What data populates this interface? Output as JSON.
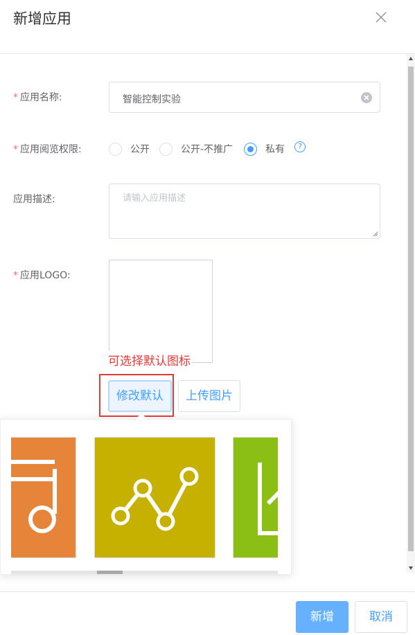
{
  "dialog": {
    "title": "新增应用",
    "close_icon": "close-icon"
  },
  "form": {
    "name": {
      "label": "应用名称:",
      "required_mark": "*",
      "value": "智能控制实验",
      "clear_icon": "clear-icon"
    },
    "permission": {
      "label": "应用阅览权限:",
      "required_mark": "*",
      "options": [
        {
          "label": "公开",
          "checked": false
        },
        {
          "label": "公开-不推广",
          "checked": false
        },
        {
          "label": "私有",
          "checked": true
        }
      ],
      "help_icon_text": "?"
    },
    "description": {
      "label": "应用描述:",
      "placeholder": "请输入应用描述",
      "value": ""
    },
    "logo": {
      "label": "应用LOGO:",
      "required_mark": "*",
      "annotation": "可选择默认图标",
      "modify_button": "修改默认",
      "upload_button": "上传图片"
    }
  },
  "icon_picker": {
    "icons": [
      {
        "name": "music-note-icon",
        "color": "#e6843a"
      },
      {
        "name": "line-chart-icon",
        "color": "#c6b000"
      },
      {
        "name": "area-chart-icon",
        "color": "#8cbf14"
      }
    ]
  },
  "footer": {
    "confirm_button": "新增",
    "cancel_button": "取消"
  },
  "colors": {
    "primary": "#409eff",
    "required": "#f56c6c",
    "annotation": "#e53935"
  }
}
